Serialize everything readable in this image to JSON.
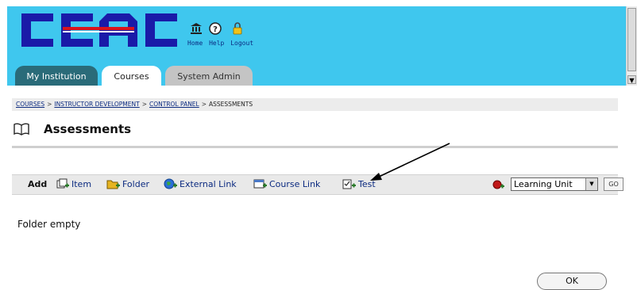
{
  "header": {
    "logo_text": "CCAC",
    "links": [
      "Home",
      "Help",
      "Logout"
    ],
    "icons": [
      "institution-icon",
      "help-icon",
      "lock-icon"
    ]
  },
  "tabs": [
    {
      "label": "My Institution"
    },
    {
      "label": "Courses"
    },
    {
      "label": "System Admin"
    }
  ],
  "breadcrumb": {
    "items": [
      "COURSES",
      "INSTRUCTOR DEVELOPMENT",
      "CONTROL PANEL"
    ],
    "separator": ">",
    "current": "ASSESSMENTS"
  },
  "page": {
    "title": "Assessments",
    "empty_message": "Folder empty"
  },
  "toolbar": {
    "add_label": "Add",
    "items": [
      {
        "label": "Item",
        "icon": "add-item-icon"
      },
      {
        "label": "Folder",
        "icon": "add-folder-icon"
      },
      {
        "label": "External Link",
        "icon": "external-link-icon"
      },
      {
        "label": "Course Link",
        "icon": "course-link-icon"
      },
      {
        "label": "Test",
        "icon": "add-test-icon"
      }
    ],
    "select_value": "Learning Unit",
    "go_label": "GO"
  },
  "ok_label": "OK",
  "colors": {
    "banner": "#3fc7ee",
    "link": "#0b2a80",
    "tab_active": "#ffffff",
    "tab_institution": "#2a6b79",
    "tab_admin": "#c4c4c4"
  }
}
